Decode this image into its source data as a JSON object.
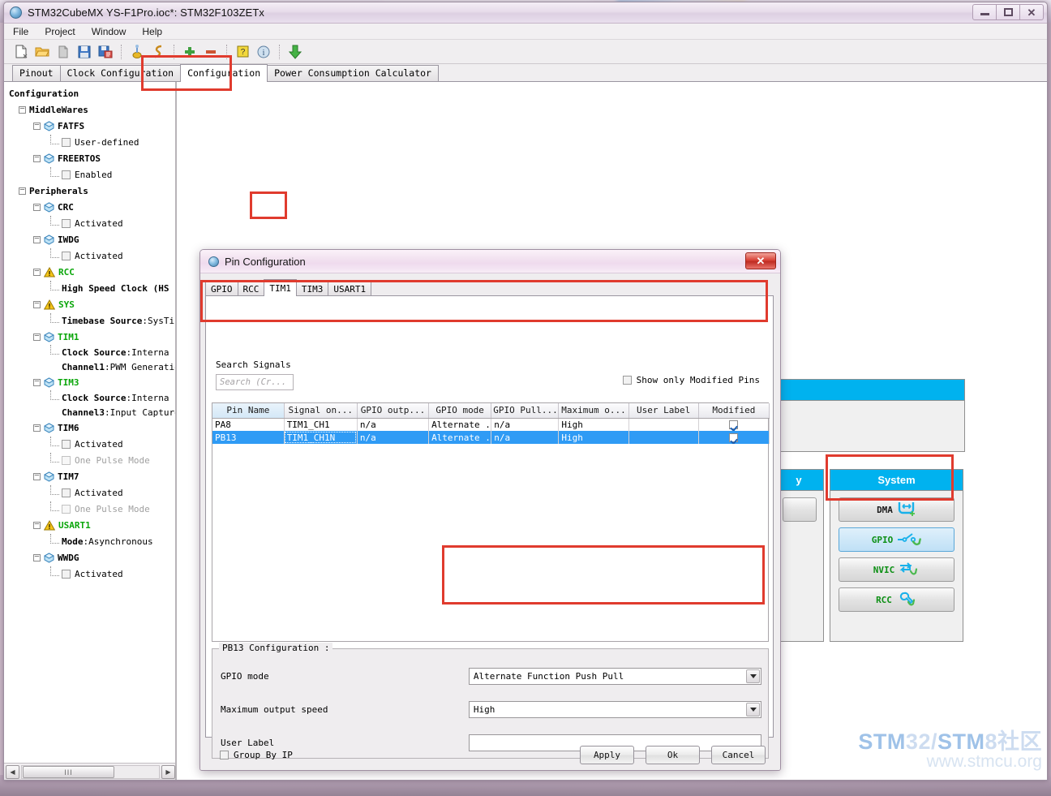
{
  "window": {
    "title": "STM32CubeMX YS-F1Pro.ioc*: STM32F103ZETx",
    "icon": "cube-icon",
    "minimize": "minimize-icon",
    "maximize": "maximize-icon",
    "close": "close-icon"
  },
  "menubar": {
    "items": [
      {
        "label": "File"
      },
      {
        "label": "Project"
      },
      {
        "label": "Window"
      },
      {
        "label": "Help"
      }
    ]
  },
  "toolbar": {
    "icons": [
      {
        "name": "new-project-icon"
      },
      {
        "name": "open-project-icon"
      },
      {
        "name": "copy-icon"
      },
      {
        "name": "save-icon"
      },
      {
        "name": "save-as-icon"
      },
      {
        "name": "generate-report-icon"
      },
      {
        "name": "generate-code-icon"
      },
      {
        "name": "zoom-in-icon"
      },
      {
        "name": "zoom-out-icon"
      },
      {
        "name": "help-icon"
      },
      {
        "name": "about-icon"
      },
      {
        "name": "download-icon"
      }
    ]
  },
  "main_tabs": {
    "items": [
      {
        "label": "Pinout",
        "selected": false
      },
      {
        "label": "Clock Configuration",
        "selected": false
      },
      {
        "label": "Configuration",
        "selected": true
      },
      {
        "label": "Power Consumption Calculator",
        "selected": false
      }
    ]
  },
  "tree": {
    "root_label": "Configuration",
    "nodes": [
      {
        "level": 1,
        "type": "group",
        "label": "MiddleWares",
        "color": "black"
      },
      {
        "level": 2,
        "type": "ip",
        "label": "FATFS",
        "color": "black"
      },
      {
        "level": 3,
        "type": "check",
        "label": "User-defined",
        "color": "black",
        "checked": false
      },
      {
        "level": 2,
        "type": "ip",
        "label": "FREERTOS",
        "color": "black"
      },
      {
        "level": 3,
        "type": "check",
        "label": "Enabled",
        "color": "black",
        "checked": false
      },
      {
        "level": 1,
        "type": "group",
        "label": "Peripherals",
        "color": "black"
      },
      {
        "level": 2,
        "type": "ip",
        "label": "CRC",
        "color": "black"
      },
      {
        "level": 3,
        "type": "check",
        "label": "Activated",
        "color": "black",
        "checked": false
      },
      {
        "level": 2,
        "type": "ip",
        "label": "IWDG",
        "color": "black"
      },
      {
        "level": 3,
        "type": "check",
        "label": "Activated",
        "color": "black",
        "checked": false
      },
      {
        "level": 2,
        "type": "warn",
        "label": "RCC",
        "color": "green"
      },
      {
        "level": 3,
        "type": "kv",
        "key": "High Speed Clock (HS",
        "value": "",
        "color": "black"
      },
      {
        "level": 2,
        "type": "warn",
        "label": "SYS",
        "color": "green"
      },
      {
        "level": 3,
        "type": "kv",
        "key": "Timebase Source",
        "value": ":SysTi",
        "color": "black"
      },
      {
        "level": 2,
        "type": "ip",
        "label": "TIM1",
        "color": "green"
      },
      {
        "level": 3,
        "type": "kv",
        "key": "Clock Source ",
        "value": ":Interna",
        "color": "black"
      },
      {
        "level": 3,
        "type": "kv2",
        "key": "Channel1",
        "value": ":PWM Generatio",
        "color": "black"
      },
      {
        "level": 2,
        "type": "ip",
        "label": "TIM3",
        "color": "green"
      },
      {
        "level": 3,
        "type": "kv",
        "key": "Clock Source ",
        "value": ":Interna",
        "color": "black"
      },
      {
        "level": 3,
        "type": "kv2",
        "key": "Channel3",
        "value": ":Input Capture",
        "color": "black"
      },
      {
        "level": 2,
        "type": "ip",
        "label": "TIM6",
        "color": "black"
      },
      {
        "level": 3,
        "type": "check",
        "label": "Activated",
        "color": "black",
        "checked": false
      },
      {
        "level": 3,
        "type": "check",
        "label": "One Pulse Mode",
        "color": "gray",
        "checked": false
      },
      {
        "level": 2,
        "type": "ip",
        "label": "TIM7",
        "color": "black"
      },
      {
        "level": 3,
        "type": "check",
        "label": "Activated",
        "color": "black",
        "checked": false
      },
      {
        "level": 3,
        "type": "check",
        "label": "One Pulse Mode",
        "color": "gray",
        "checked": false
      },
      {
        "level": 2,
        "type": "warn",
        "label": "USART1",
        "color": "green"
      },
      {
        "level": 3,
        "type": "kv",
        "key": "Mode",
        "value": ":Asynchronous",
        "color": "black"
      },
      {
        "level": 2,
        "type": "ip",
        "label": "WWDG",
        "color": "black"
      },
      {
        "level": 3,
        "type": "check",
        "label": "Activated",
        "color": "black",
        "checked": false
      }
    ],
    "hscroll": {
      "left_arrow": "◀",
      "right_arrow": "▶",
      "thumb_grip": "III"
    }
  },
  "ip_panels": [
    {
      "id": "panel-partial",
      "title": "y",
      "buttons": []
    },
    {
      "id": "panel-system",
      "title": "System",
      "buttons": [
        {
          "label": "DMA",
          "icon": "dma-icon",
          "state": "normal",
          "label_color": "#1a1a1a"
        },
        {
          "label": "GPIO",
          "icon": "gpio-icon",
          "state": "selected",
          "label_color": "#0c8f14"
        },
        {
          "label": "NVIC",
          "icon": "nvic-icon",
          "state": "normal",
          "label_color": "#0c8f14"
        },
        {
          "label": "RCC",
          "icon": "rcc-icon",
          "state": "normal",
          "label_color": "#0c8f14"
        }
      ]
    }
  ],
  "dialog": {
    "title": "Pin Configuration",
    "icon": "cube-icon",
    "close_label": "✕",
    "tabs": [
      {
        "label": "GPIO",
        "selected": false
      },
      {
        "label": "RCC",
        "selected": false
      },
      {
        "label": "TIM1",
        "selected": true
      },
      {
        "label": "TIM3",
        "selected": false
      },
      {
        "label": "USART1",
        "selected": false
      }
    ],
    "search": {
      "label": "Search Signals",
      "placeholder": "Search (Cr...",
      "value": ""
    },
    "show_only_modified": {
      "label": "Show only Modified Pins",
      "checked": false
    },
    "table": {
      "columns": [
        "Pin Name",
        "Signal on...",
        "GPIO outp...",
        "GPIO mode",
        "GPIO Pull...",
        "Maximum o...",
        "User Label",
        "Modified"
      ],
      "sorted_column": "Pin Name",
      "rows": [
        {
          "selected": false,
          "cells": [
            "PA8",
            "TIM1_CH1",
            "n/a",
            "Alternate ...",
            "n/a",
            "High",
            ""
          ],
          "modified": true
        },
        {
          "selected": true,
          "cells": [
            "PB13",
            "TIM1_CH1N",
            "n/a",
            "Alternate ...",
            "n/a",
            "High",
            ""
          ],
          "modified": true
        }
      ]
    },
    "pin_config": {
      "group_title": "PB13 Configuration :",
      "fields": [
        {
          "label": "GPIO mode",
          "type": "combo",
          "value": "Alternate Function Push Pull"
        },
        {
          "label": "Maximum output speed",
          "type": "combo",
          "value": "High"
        },
        {
          "label": "User Label",
          "type": "text",
          "value": ""
        }
      ]
    },
    "footer": {
      "group_by_ip": {
        "label": "Group By IP",
        "checked": false
      },
      "buttons": [
        {
          "label": "Apply"
        },
        {
          "label": "Ok"
        },
        {
          "label": "Cancel"
        }
      ]
    }
  },
  "watermark": {
    "line1_a": "STM",
    "line1_b": "32/",
    "line1_c": "STM",
    "line1_d": "8社区",
    "line2": "www.stmcu.org"
  },
  "annotations": {
    "color": "#e03b2e",
    "boxes": [
      {
        "name": "configuration-tab-highlight"
      },
      {
        "name": "tim1-tab-highlight"
      },
      {
        "name": "pin-table-highlight"
      },
      {
        "name": "gpio-mode-speed-highlight"
      },
      {
        "name": "gpio-button-highlight"
      }
    ]
  }
}
